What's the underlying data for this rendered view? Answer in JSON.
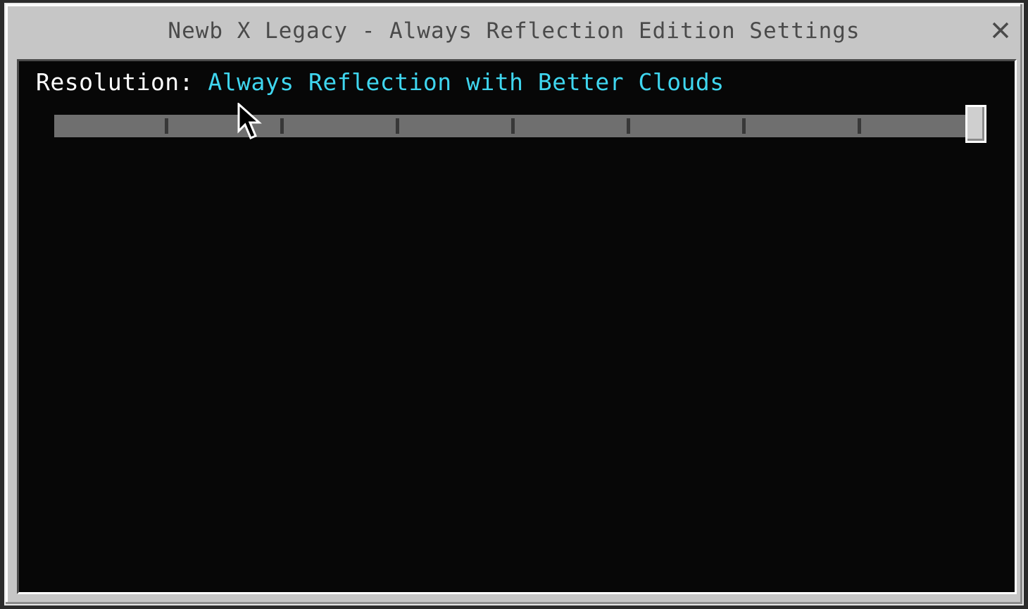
{
  "window": {
    "title": "Newb X Legacy - Always Reflection Edition Settings",
    "close_icon": "close-icon"
  },
  "setting": {
    "label": "Resolution:",
    "value": "Always Reflection with Better Clouds",
    "value_color": "#3fd6ef",
    "slider_position_fraction": 1.0,
    "slider_steps": 9
  },
  "colors": {
    "background": "#070707",
    "frame": "#c6c6c6",
    "title_text": "#4a4a4a",
    "label_text": "#ffffff"
  }
}
